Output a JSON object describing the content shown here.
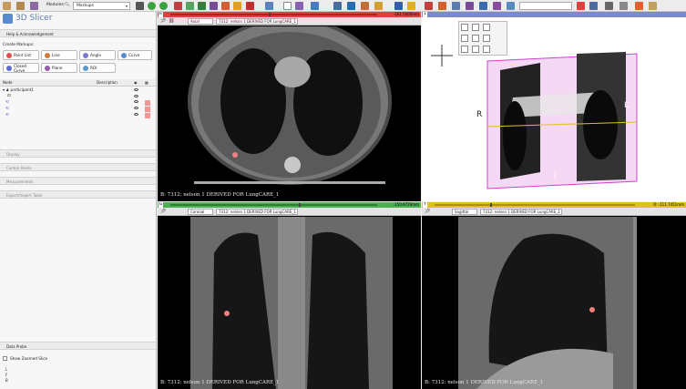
{
  "toolbar": {
    "modules_label": "Modules:",
    "module_value": "Markups",
    "colors": {
      "bg": "#ececec",
      "red": "#e04040",
      "green": "#3aa040",
      "yellow": "#e0c020",
      "blue": "#3a6cc4"
    }
  },
  "app": {
    "logo_text": "3D Slicer"
  },
  "panel": {
    "help_section": "Help & Acknowledgement",
    "create_label": "Create Markups:",
    "buttons": [
      "Point List",
      "Line",
      "Angle",
      "Curve",
      "Closed Curve",
      "Plane",
      "ROI"
    ],
    "tree_headers": {
      "node": "Node",
      "description": "Description"
    },
    "tree_items": [
      "participant1"
    ],
    "sections": [
      "Display",
      "Control Points",
      "Measurements",
      "Export/Import Table"
    ],
    "data_probe": "Data Probe",
    "show_zoomed": "Show Zoomed Slice",
    "probe_labels": [
      "L",
      "F",
      "B"
    ]
  },
  "views": {
    "red": {
      "name": "R",
      "orientation": "Axial",
      "volume": "7312: nelson 1 DERIVED FOR LungCARE_1",
      "offset": "-161.5000mm",
      "corner": "B: 7312: nelson 1 DERIVED FOR LungCARE_1"
    },
    "green": {
      "name": "G",
      "orientation": "Coronal",
      "volume": "7312: nelson 1 DERIVED FOR LungCARE_1",
      "offset": "-150.9729mm",
      "corner": "B: 7312: nelson 1 DERIVED FOR LungCARE_1"
    },
    "yellow": {
      "name": "Y",
      "orientation": "Sagittal",
      "volume": "7312: nelson 1 DERIVED FOR LungCARE_1",
      "offset": "R: -111.7451mm",
      "corner": "B: 7312: nelson 1 DERIVED FOR LungCARE_1"
    },
    "threed": {
      "name": "1",
      "labels": {
        "s": "S",
        "r": "R",
        "l": "L",
        "i": "I"
      }
    }
  }
}
